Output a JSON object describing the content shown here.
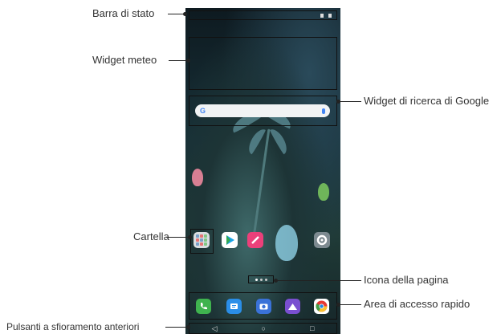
{
  "labels": {
    "status_bar": "Barra di stato",
    "weather_widget": "Widget meteo",
    "google_search_widget": "Widget di ricerca di Google",
    "folder": "Cartella",
    "page_icon": "Icona della pagina",
    "quick_access": "Area di accesso rapido",
    "front_touch_buttons": "Pulsanti a sfioramento anteriori"
  },
  "icons": {
    "google_logo": "G",
    "nav_back": "◁",
    "nav_home": "○",
    "nav_recent": "□"
  },
  "colors": {
    "phone_call": "#3fb34f",
    "messages": "#2a8ee8",
    "camera": "#3a72d8",
    "gallery": "#7a4fd0",
    "chrome_red": "#e53935",
    "play_blue": "#1aa3e8",
    "edit_pink": "#ec407a",
    "settings_grey": "#7d8a90"
  }
}
